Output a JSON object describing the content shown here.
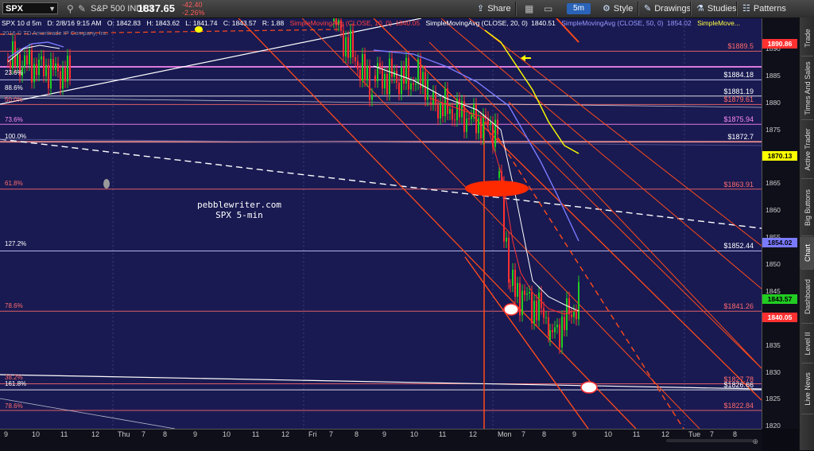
{
  "toolbar": {
    "symbol": "SPX",
    "index_name": "S&P 500 INDEX",
    "last": "1837.65",
    "change": "-42.40",
    "change_pct": "-2.26%",
    "share": "Share",
    "timeframe": "5m",
    "style": "Style",
    "drawings": "Drawings",
    "studies": "Studies",
    "patterns": "Patterns"
  },
  "chart_header": {
    "desc": "SPX 10 d 5m",
    "time": "D: 2/8/16 9:15 AM",
    "open": "O: 1842.83",
    "high": "H: 1843.62",
    "low": "L: 1841.74",
    "close": "C: 1843.57",
    "range": "R: 1.88",
    "sma10": "SimpleMovingAvg (CLOSE, 10, 0)",
    "sma10_val": "1840.05",
    "sma20": "SimpleMovingAvg (CLOSE, 20, 0)",
    "sma20_val": "1840.51",
    "sma50": "SimpleMovingAvg (CLOSE, 50, 0)",
    "sma50_val": "1854.02",
    "sma_more": "SimpleMove...",
    "copyright": "2016 © TD Ameritrade IP Company, Inc."
  },
  "watermark": {
    "line1": "pebblewriter.com",
    "line2": "SPX 5-min"
  },
  "fib_labels": [
    {
      "text": "23.6%",
      "color": "#ffffff"
    },
    {
      "text": "88.6%",
      "color": "#ffffff"
    },
    {
      "text": "50.0%",
      "color": "#ff6b6b"
    },
    {
      "text": "73.6%",
      "color": "#ff8af5"
    },
    {
      "text": "100.0%",
      "color": "#ffffff"
    },
    {
      "text": "61.8%",
      "color": "#ff6b6b"
    },
    {
      "text": "127.2%",
      "color": "#ffffff"
    },
    {
      "text": "78.6%",
      "color": "#ff6b6b"
    },
    {
      "text": "38.2%",
      "color": "#ff6b6b"
    },
    {
      "text": "161.8%",
      "color": "#ffffff"
    },
    {
      "text": "78.6%",
      "color": "#ff6b6b"
    }
  ],
  "price_labels": [
    {
      "text": "$1889.5",
      "color": "#ff6b6b"
    },
    {
      "text": "$1884.18",
      "color": "#ffffff"
    },
    {
      "text": "$1881.19",
      "color": "#ffffff"
    },
    {
      "text": "$1879.61",
      "color": "#ff6b6b"
    },
    {
      "text": "$1875.94",
      "color": "#ff8af5"
    },
    {
      "text": "$1872.7",
      "color": "#ffffff"
    },
    {
      "text": "$1863.91",
      "color": "#ff6b6b"
    },
    {
      "text": "$1852.44",
      "color": "#ffffff"
    },
    {
      "text": "$1841.26",
      "color": "#ff6b6b"
    },
    {
      "text": "$1827.78",
      "color": "#ff6b6b"
    },
    {
      "text": "$1826.66",
      "color": "#ffffff"
    },
    {
      "text": "$1822.84",
      "color": "#ff6b6b"
    }
  ],
  "y_ticks": [
    "1890",
    "1885",
    "1880",
    "1875",
    "1870",
    "1865",
    "1860",
    "1855",
    "1850",
    "1845",
    "1840",
    "1835",
    "1830",
    "1825",
    "1820"
  ],
  "y_tags": [
    {
      "text": "1890.86",
      "bg": "#ff3030",
      "fg": "#ffffff"
    },
    {
      "text": "1870.13",
      "bg": "#ffff00",
      "fg": "#000000"
    },
    {
      "text": "1854.02",
      "bg": "#7a7aff",
      "fg": "#000000"
    },
    {
      "text": "1843.57",
      "bg": "#22cc22",
      "fg": "#000000"
    },
    {
      "text": "1840.05",
      "bg": "#ff3030",
      "fg": "#ffffff"
    }
  ],
  "x_ticks": [
    "9",
    "10",
    "11",
    "12",
    "Thu",
    "7",
    "8",
    "9",
    "10",
    "11",
    "12",
    "Fri",
    "7",
    "8",
    "9",
    "10",
    "11",
    "12",
    "Mon",
    "7",
    "8",
    "9",
    "10",
    "11",
    "12",
    "Tue",
    "7",
    "8"
  ],
  "sidebar": [
    "Trade",
    "Times And Sales",
    "Active Trader",
    "Big Buttons",
    "Chart",
    "Dashboard",
    "Level II",
    "Live News"
  ],
  "colors": {
    "chart_bg": "#191a52",
    "fib_red": "#ff6b6b",
    "channel": "#ff4a1a",
    "sma10": "#ff3030",
    "sma20": "#ffffff",
    "sma50": "#7a7aff",
    "sma_yellow": "#ffff00"
  }
}
